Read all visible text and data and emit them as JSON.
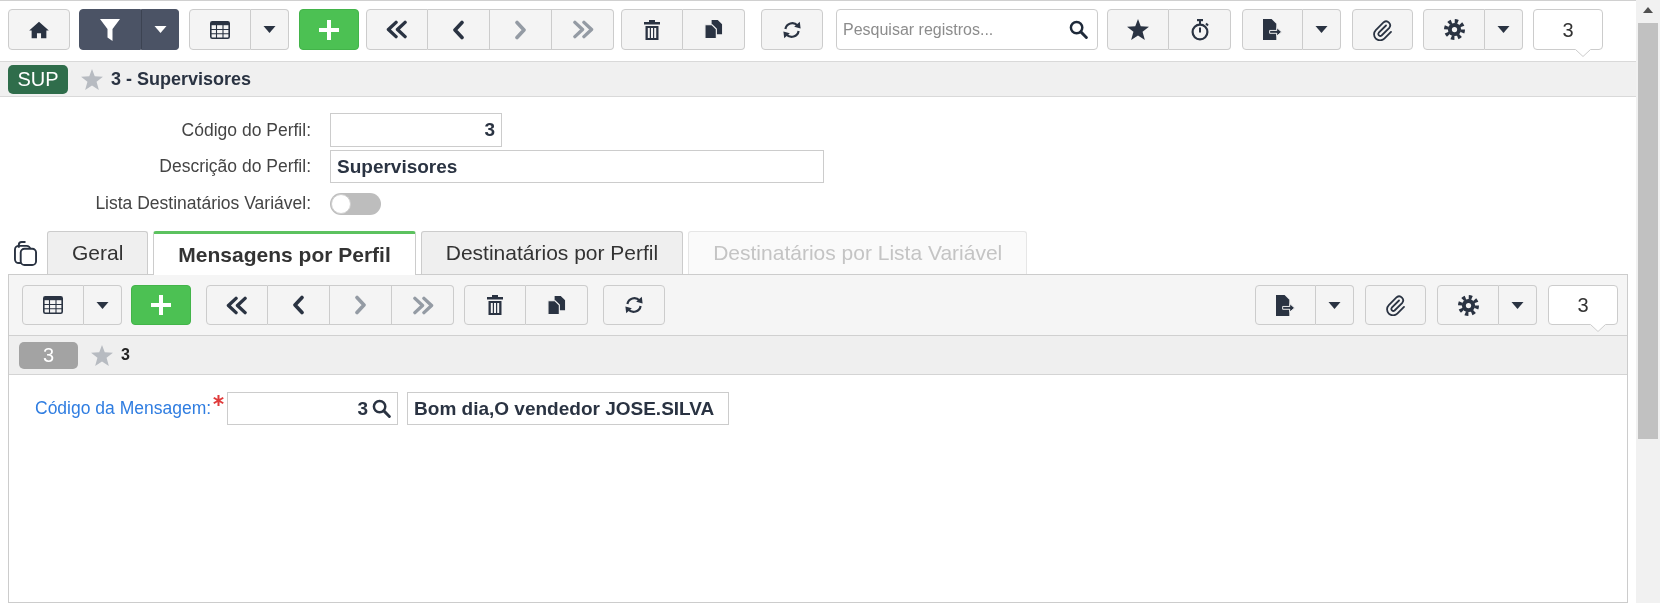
{
  "toolbar": {
    "filter_active": true,
    "navigation": [
      {
        "disabled": false
      },
      {
        "disabled": false
      },
      {
        "disabled": true
      },
      {
        "disabled": true
      }
    ],
    "search": {
      "placeholder": "Pesquisar registros..."
    },
    "record_count": "3"
  },
  "record_header": {
    "badge": "SUP",
    "favorite": false,
    "title": "3 - Supervisores"
  },
  "form": {
    "fields": [
      {
        "kind": "number",
        "label": "Código do Perfil:",
        "value": "3"
      },
      {
        "kind": "text",
        "label": "Descrição do Perfil:",
        "value": "Supervisores"
      },
      {
        "kind": "toggle",
        "label": "Lista Destinatários Variável:",
        "on": false
      }
    ]
  },
  "tabs": [
    {
      "label": "Geral",
      "selected": false,
      "disabled": false
    },
    {
      "label": "Mensagens por Perfil",
      "selected": true,
      "disabled": false
    },
    {
      "label": "Destinatários por Perfil",
      "selected": false,
      "disabled": false
    },
    {
      "label": "Destinatários por Lista Variável",
      "selected": false,
      "disabled": true
    }
  ],
  "detail": {
    "toolbar": {
      "navigation": [
        {
          "disabled": false
        },
        {
          "disabled": false
        },
        {
          "disabled": true
        },
        {
          "disabled": true
        }
      ],
      "record_count": "3"
    },
    "record_header": {
      "badge": "3",
      "favorite": false,
      "title": "3"
    },
    "fields": [
      {
        "kind": "lookup",
        "label": "Código da Mensagem:",
        "required": true,
        "value": "3",
        "description": "Bom dia,O vendedor JOSE.SILVA"
      }
    ]
  }
}
